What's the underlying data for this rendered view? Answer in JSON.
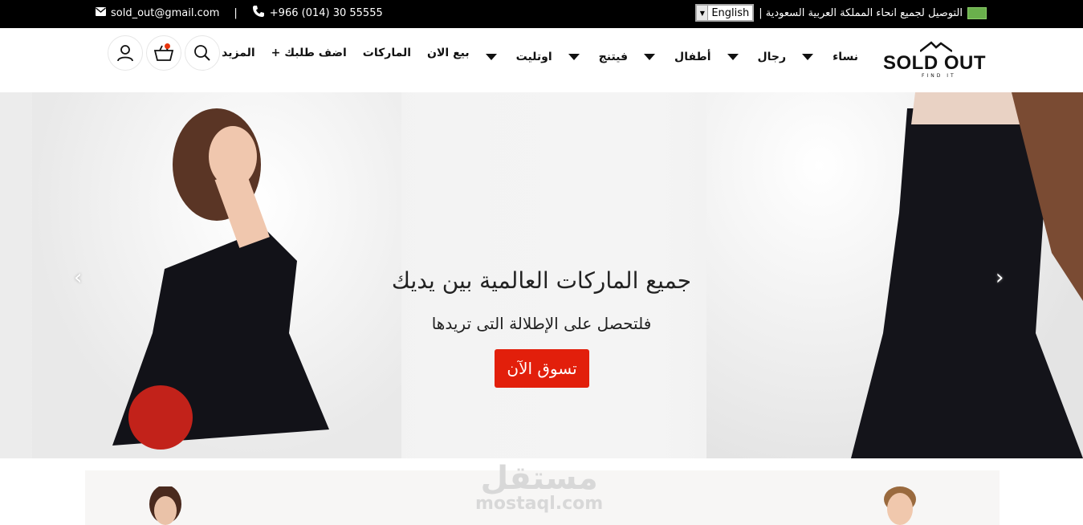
{
  "topbar": {
    "email": "sold_out@gmail.com",
    "separator": "|",
    "phone": "+966 (014) 30 55555",
    "language": "English",
    "shipping_note": "التوصيل لجميع انحاء المملكة العربية السعودية |"
  },
  "brand": {
    "name": "SOLD OUT",
    "tagline": "FIND IT"
  },
  "nav": {
    "items": [
      {
        "label": "نساء",
        "dropdown": true
      },
      {
        "label": "رجال",
        "dropdown": true
      },
      {
        "label": "أطفال",
        "dropdown": true
      },
      {
        "label": "فيتنج",
        "dropdown": true
      },
      {
        "label": "اوتليت",
        "dropdown": true
      },
      {
        "label": "بيع الان",
        "dropdown": false
      },
      {
        "label": "الماركات",
        "dropdown": false
      },
      {
        "label": "اضف طلبك +",
        "dropdown": false
      },
      {
        "label": "المزيد",
        "dropdown": false
      }
    ]
  },
  "icons": [
    "search-icon",
    "cart-icon",
    "user-icon"
  ],
  "hero": {
    "title": "جميع الماركات العالمية بين يديك",
    "subtitle": "فلتحصل على الإطلالة التى تريدها",
    "cta": "تسوق الآن",
    "prev": "‹",
    "next": "›"
  },
  "watermark": {
    "arabic": "مستقل",
    "latin": "mostaql.com"
  },
  "colors": {
    "accent": "#e21f0b",
    "topbar": "#000000"
  }
}
